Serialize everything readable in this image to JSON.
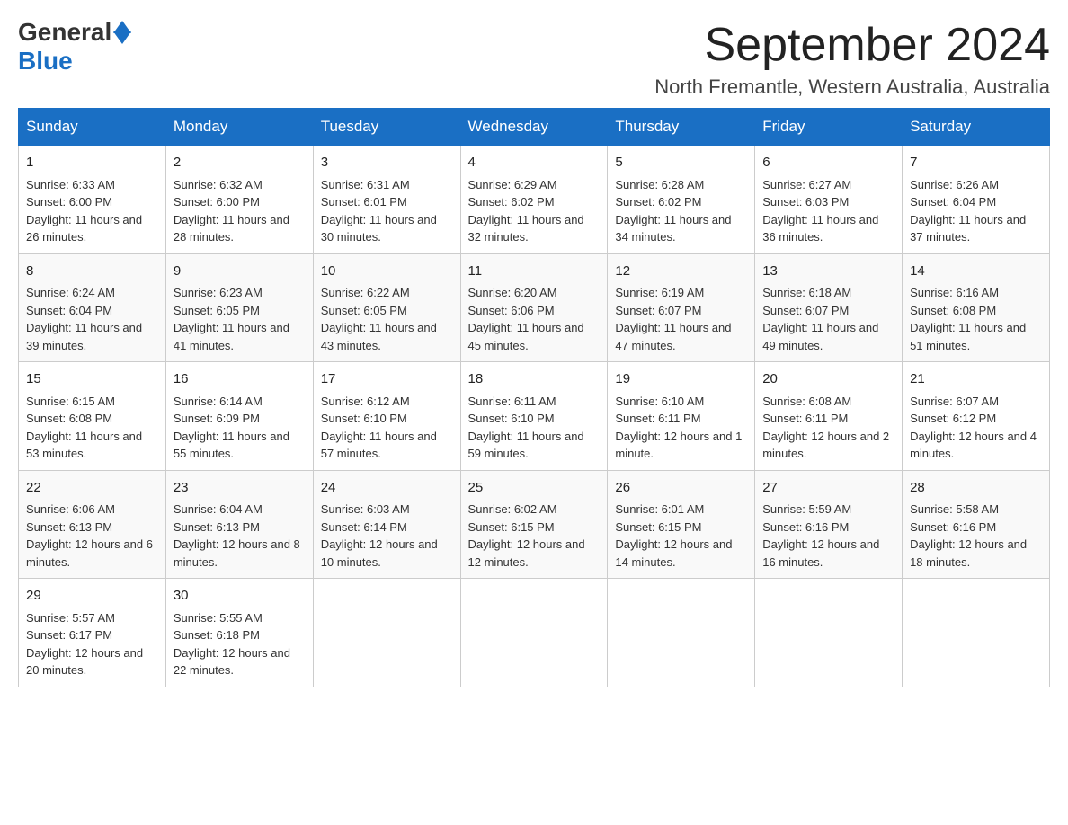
{
  "header": {
    "logo_general": "General",
    "logo_blue": "Blue",
    "month_title": "September 2024",
    "location": "North Fremantle, Western Australia, Australia"
  },
  "weekdays": [
    "Sunday",
    "Monday",
    "Tuesday",
    "Wednesday",
    "Thursday",
    "Friday",
    "Saturday"
  ],
  "weeks": [
    [
      {
        "day": "1",
        "sunrise": "6:33 AM",
        "sunset": "6:00 PM",
        "daylight": "11 hours and 26 minutes."
      },
      {
        "day": "2",
        "sunrise": "6:32 AM",
        "sunset": "6:00 PM",
        "daylight": "11 hours and 28 minutes."
      },
      {
        "day": "3",
        "sunrise": "6:31 AM",
        "sunset": "6:01 PM",
        "daylight": "11 hours and 30 minutes."
      },
      {
        "day": "4",
        "sunrise": "6:29 AM",
        "sunset": "6:02 PM",
        "daylight": "11 hours and 32 minutes."
      },
      {
        "day": "5",
        "sunrise": "6:28 AM",
        "sunset": "6:02 PM",
        "daylight": "11 hours and 34 minutes."
      },
      {
        "day": "6",
        "sunrise": "6:27 AM",
        "sunset": "6:03 PM",
        "daylight": "11 hours and 36 minutes."
      },
      {
        "day": "7",
        "sunrise": "6:26 AM",
        "sunset": "6:04 PM",
        "daylight": "11 hours and 37 minutes."
      }
    ],
    [
      {
        "day": "8",
        "sunrise": "6:24 AM",
        "sunset": "6:04 PM",
        "daylight": "11 hours and 39 minutes."
      },
      {
        "day": "9",
        "sunrise": "6:23 AM",
        "sunset": "6:05 PM",
        "daylight": "11 hours and 41 minutes."
      },
      {
        "day": "10",
        "sunrise": "6:22 AM",
        "sunset": "6:05 PM",
        "daylight": "11 hours and 43 minutes."
      },
      {
        "day": "11",
        "sunrise": "6:20 AM",
        "sunset": "6:06 PM",
        "daylight": "11 hours and 45 minutes."
      },
      {
        "day": "12",
        "sunrise": "6:19 AM",
        "sunset": "6:07 PM",
        "daylight": "11 hours and 47 minutes."
      },
      {
        "day": "13",
        "sunrise": "6:18 AM",
        "sunset": "6:07 PM",
        "daylight": "11 hours and 49 minutes."
      },
      {
        "day": "14",
        "sunrise": "6:16 AM",
        "sunset": "6:08 PM",
        "daylight": "11 hours and 51 minutes."
      }
    ],
    [
      {
        "day": "15",
        "sunrise": "6:15 AM",
        "sunset": "6:08 PM",
        "daylight": "11 hours and 53 minutes."
      },
      {
        "day": "16",
        "sunrise": "6:14 AM",
        "sunset": "6:09 PM",
        "daylight": "11 hours and 55 minutes."
      },
      {
        "day": "17",
        "sunrise": "6:12 AM",
        "sunset": "6:10 PM",
        "daylight": "11 hours and 57 minutes."
      },
      {
        "day": "18",
        "sunrise": "6:11 AM",
        "sunset": "6:10 PM",
        "daylight": "11 hours and 59 minutes."
      },
      {
        "day": "19",
        "sunrise": "6:10 AM",
        "sunset": "6:11 PM",
        "daylight": "12 hours and 1 minute."
      },
      {
        "day": "20",
        "sunrise": "6:08 AM",
        "sunset": "6:11 PM",
        "daylight": "12 hours and 2 minutes."
      },
      {
        "day": "21",
        "sunrise": "6:07 AM",
        "sunset": "6:12 PM",
        "daylight": "12 hours and 4 minutes."
      }
    ],
    [
      {
        "day": "22",
        "sunrise": "6:06 AM",
        "sunset": "6:13 PM",
        "daylight": "12 hours and 6 minutes."
      },
      {
        "day": "23",
        "sunrise": "6:04 AM",
        "sunset": "6:13 PM",
        "daylight": "12 hours and 8 minutes."
      },
      {
        "day": "24",
        "sunrise": "6:03 AM",
        "sunset": "6:14 PM",
        "daylight": "12 hours and 10 minutes."
      },
      {
        "day": "25",
        "sunrise": "6:02 AM",
        "sunset": "6:15 PM",
        "daylight": "12 hours and 12 minutes."
      },
      {
        "day": "26",
        "sunrise": "6:01 AM",
        "sunset": "6:15 PM",
        "daylight": "12 hours and 14 minutes."
      },
      {
        "day": "27",
        "sunrise": "5:59 AM",
        "sunset": "6:16 PM",
        "daylight": "12 hours and 16 minutes."
      },
      {
        "day": "28",
        "sunrise": "5:58 AM",
        "sunset": "6:16 PM",
        "daylight": "12 hours and 18 minutes."
      }
    ],
    [
      {
        "day": "29",
        "sunrise": "5:57 AM",
        "sunset": "6:17 PM",
        "daylight": "12 hours and 20 minutes."
      },
      {
        "day": "30",
        "sunrise": "5:55 AM",
        "sunset": "6:18 PM",
        "daylight": "12 hours and 22 minutes."
      },
      null,
      null,
      null,
      null,
      null
    ]
  ],
  "labels": {
    "sunrise": "Sunrise:",
    "sunset": "Sunset:",
    "daylight": "Daylight:"
  }
}
